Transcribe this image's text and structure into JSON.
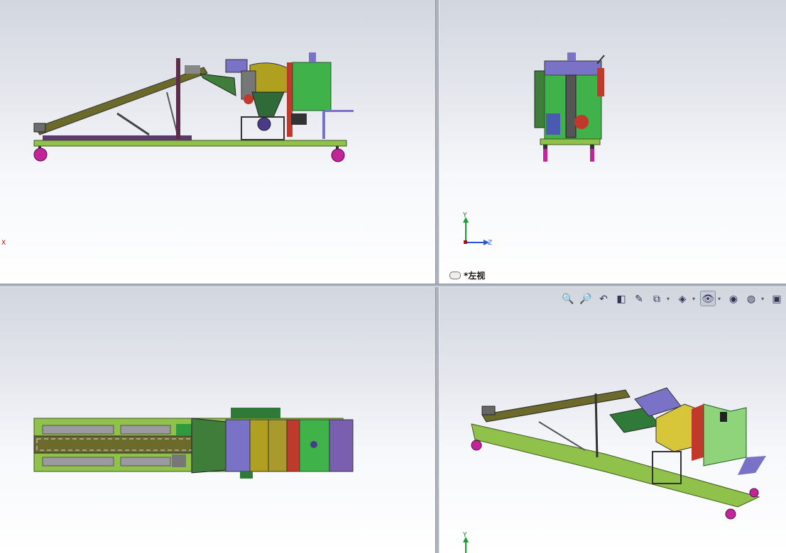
{
  "viewports": {
    "top_right": {
      "view_label": "*左视"
    },
    "axis_labels": {
      "x": "X",
      "y": "Y",
      "z": "Z"
    }
  },
  "toolbar": {
    "buttons": [
      {
        "icon": "zoom-to-fit-icon",
        "glyph": "🔍"
      },
      {
        "icon": "zoom-to-area-icon",
        "glyph": "🔎"
      },
      {
        "icon": "previous-view-icon",
        "glyph": "↶"
      },
      {
        "icon": "section-view-icon",
        "glyph": "◧"
      },
      {
        "icon": "dynamic-annotation-icon",
        "glyph": "✎"
      },
      {
        "icon": "view-orientation-icon",
        "glyph": "⧉"
      },
      {
        "icon": "display-style-icon",
        "glyph": "◈"
      },
      {
        "icon": "hide-show-icon",
        "glyph": "👁"
      },
      {
        "icon": "edit-appearance-icon",
        "glyph": "◉"
      },
      {
        "icon": "apply-scene-icon",
        "glyph": "◍"
      },
      {
        "icon": "view-settings-icon",
        "glyph": "▣"
      }
    ]
  },
  "colors": {
    "frame": "#8fc14b",
    "conveyor": "#6b6a2a",
    "hopper_dark": "#3f7d3a",
    "green_box": "#3fb34a",
    "violet": "#7a72c6",
    "mustard": "#b0a020",
    "red": "#c0392b",
    "wheel": "#c2259a",
    "light_green": "#8fd47a"
  }
}
